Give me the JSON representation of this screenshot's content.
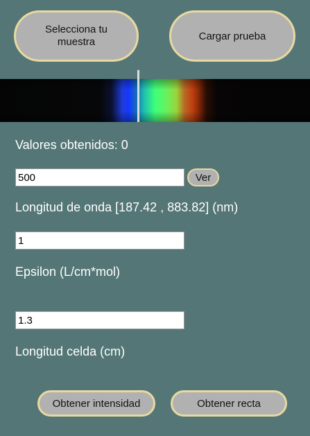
{
  "header": {
    "select_sample_label": "Selecciona tu muestra",
    "load_test_label": "Cargar prueba"
  },
  "spectrum": {
    "marker_icon": "wavelength-marker"
  },
  "results": {
    "values_obtained": "Valores obtenidos: 0"
  },
  "wavelength": {
    "value": "500",
    "view_label": "Ver",
    "label": "Longitud de onda [187.42 , 883.82] (nm)"
  },
  "epsilon": {
    "value": "1",
    "label": "Epsilon (L/cm*mol)"
  },
  "cell": {
    "value": "1.3",
    "label": "Longitud celda (cm)"
  },
  "actions": {
    "get_intensity_label": "Obtener intensidad",
    "get_line_label": "Obtener recta"
  },
  "colors": {
    "background": "#547676",
    "button_fill": "#b1b1b1",
    "button_border": "#e8d9a0"
  }
}
